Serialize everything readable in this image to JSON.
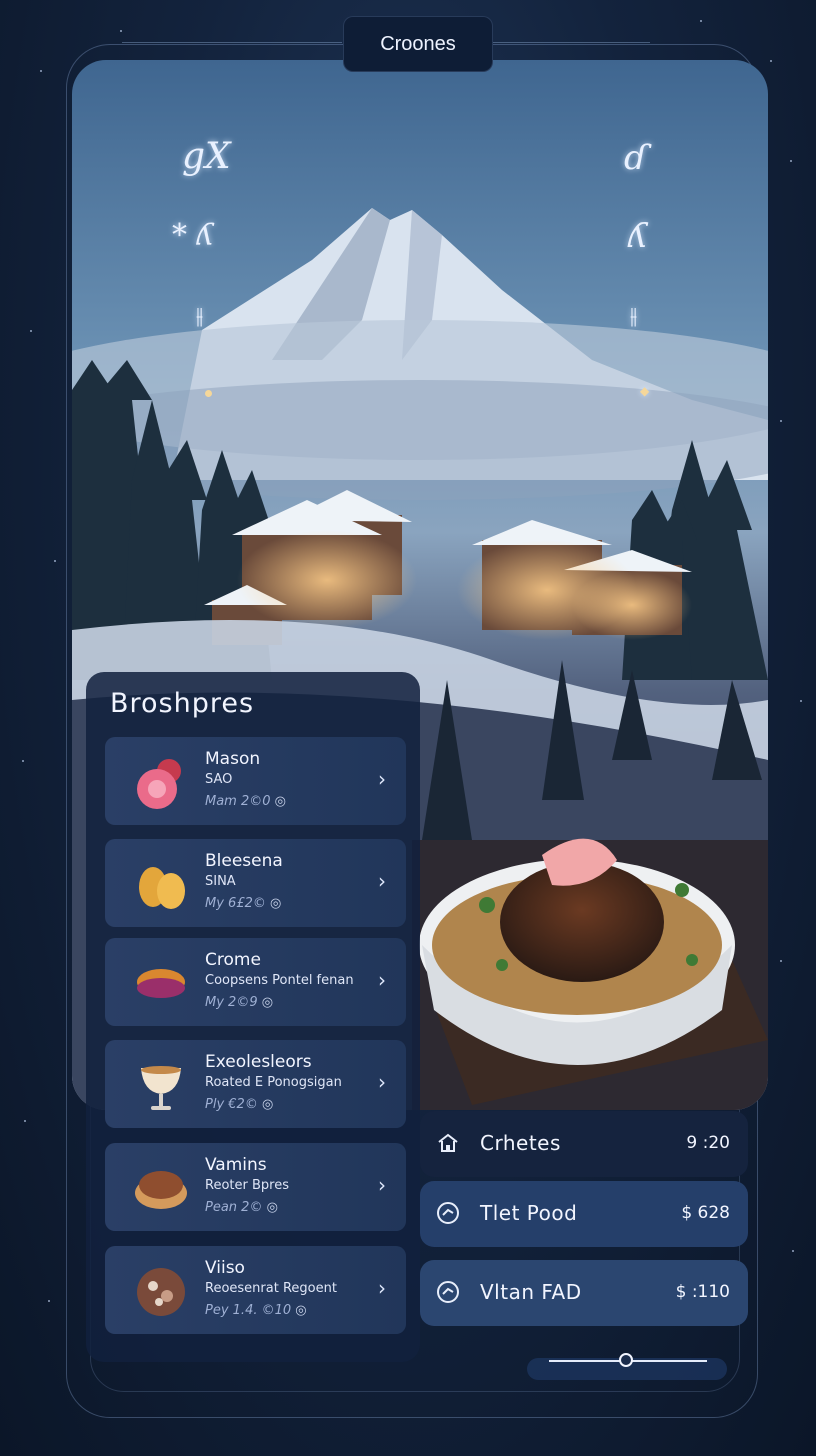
{
  "header": {
    "title": "Croones"
  },
  "glyphs": {
    "top_left": "gX",
    "top_right": "ɗ",
    "mid_left": "* ʎ",
    "mid_right": "ʎ",
    "low_left": "⫲",
    "low_right": "⫲",
    "dot_right": "◆"
  },
  "list": {
    "title": "Broshpres",
    "items": [
      {
        "name": "Mason",
        "sub": "SAO",
        "meta": "Mam 2©0"
      },
      {
        "name": "Bleesena",
        "sub": "SINA",
        "meta": "My 6£2©"
      },
      {
        "name": "Crome",
        "sub": "Coopsens Pontel fenan",
        "meta": "My 2©9"
      },
      {
        "name": "Exeolesleors",
        "sub": "Roated E Ponogsigan",
        "meta": "Ply €2©"
      },
      {
        "name": "Vamins",
        "sub": "Reoter Bpres",
        "meta": "Pean 2©"
      },
      {
        "name": "Viiso",
        "sub": "Reoesenrat Regoent",
        "meta": "Pey 1.4. ©10"
      }
    ]
  },
  "cards": [
    {
      "label": "Crhetes",
      "value": "9 :20",
      "icon": "home-icon"
    },
    {
      "label": "Tlet Pood",
      "value": "$ 628",
      "icon": "compass-icon"
    },
    {
      "label": "Vltan FAD",
      "value": "$ :110",
      "icon": "compass-icon"
    }
  ],
  "slider": {
    "value": 0.4
  },
  "colors": {
    "background": "#13233d",
    "panel": "#12213e",
    "accent": "#e5ecfa"
  }
}
